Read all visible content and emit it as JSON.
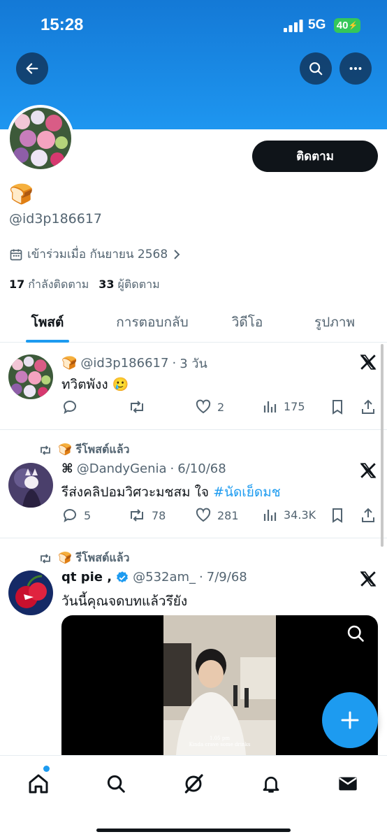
{
  "status_bar": {
    "time": "15:28",
    "network": "5G",
    "battery": "40"
  },
  "profile": {
    "display_name": "🍞",
    "handle": "@id3p186617",
    "joined": "เข้าร่วมเมื่อ กันยายน 2568",
    "following_count": "17",
    "following_label": "กำลังติดตาม",
    "followers_count": "33",
    "followers_label": "ผู้ติดตาม",
    "follow_button": "ติดตาม"
  },
  "tabs": [
    {
      "label": "โพสต์",
      "active": true
    },
    {
      "label": "การตอบกลับ",
      "active": false
    },
    {
      "label": "วิดีโอ",
      "active": false
    },
    {
      "label": "รูปภาพ",
      "active": false
    }
  ],
  "posts": [
    {
      "name": "🍞",
      "handle": "@id3p186617",
      "time": "3 วัน",
      "text": "ทวิตพังง 🥲",
      "hashtag": "",
      "replies": "",
      "reposts": "",
      "likes": "2",
      "views": "175"
    },
    {
      "retweet_label": "🍞 รีโพสต์แล้ว",
      "name": "⌘",
      "handle": "@DandyGenia",
      "time": "6/10/68",
      "text": "รีส่งคลิปอมวิศวะมชสม ใจ ",
      "hashtag": "#นัดเย็ดมช",
      "replies": "5",
      "reposts": "78",
      "likes": "281",
      "views": "34.3K"
    },
    {
      "retweet_label": "🍞 รีโพสต์แล้ว",
      "name": "qt pie ,",
      "handle": "@532am_",
      "time": "7/9/68",
      "text": "วันนี้คุณจดบทแล้วรึยัง",
      "media_caption_1": "1.05 pm",
      "media_caption_2": "Kinda crave some drinks"
    }
  ],
  "colors": {
    "accent": "#1d9bf0",
    "banner": "#1e96f0",
    "text": "#0f1419",
    "muted": "#536471"
  }
}
